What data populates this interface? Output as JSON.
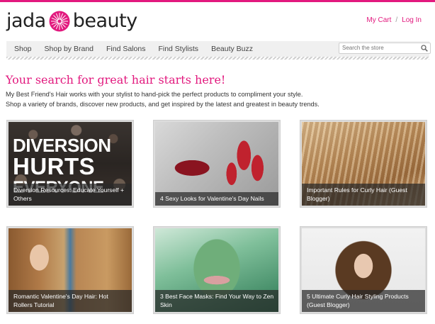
{
  "brand": {
    "word_left": "jada",
    "word_right": "beauty",
    "accent": "#e2197e"
  },
  "account": {
    "cart_label": "My Cart",
    "separator": "/",
    "login_label": "Log In"
  },
  "nav": {
    "items": [
      {
        "label": "Shop"
      },
      {
        "label": "Shop by Brand"
      },
      {
        "label": "Find Salons"
      },
      {
        "label": "Find Stylists"
      },
      {
        "label": "Beauty Buzz"
      }
    ],
    "search_placeholder": "Search the store",
    "search_icon": "magnifier-icon"
  },
  "hero": {
    "headline": "Your search for great hair starts here!",
    "intro_line1": "My Best Friend's Hair works with your stylist to hand-pick the perfect products to compliment your style.",
    "intro_line2": "Shop a variety of brands, discover new products, and get inspired by the latest and greatest in beauty trends."
  },
  "cards": [
    {
      "caption": "Diversion Resources: Educate Yourself + Others",
      "overlay_text": [
        "DIVERSION",
        "HURTS",
        "EVERYONE"
      ]
    },
    {
      "caption": "4 Sexy Looks for Valentine's Day Nails"
    },
    {
      "caption": "Important Rules for Curly Hair (Guest Blogger)"
    },
    {
      "caption": "Romantic Valentine's Day Hair: Hot Rollers Tutorial"
    },
    {
      "caption": "3 Best Face Masks: Find Your Way to Zen Skin"
    },
    {
      "caption": "5 Ultimate Curly Hair Styling Products (Guest Blogger)"
    }
  ]
}
